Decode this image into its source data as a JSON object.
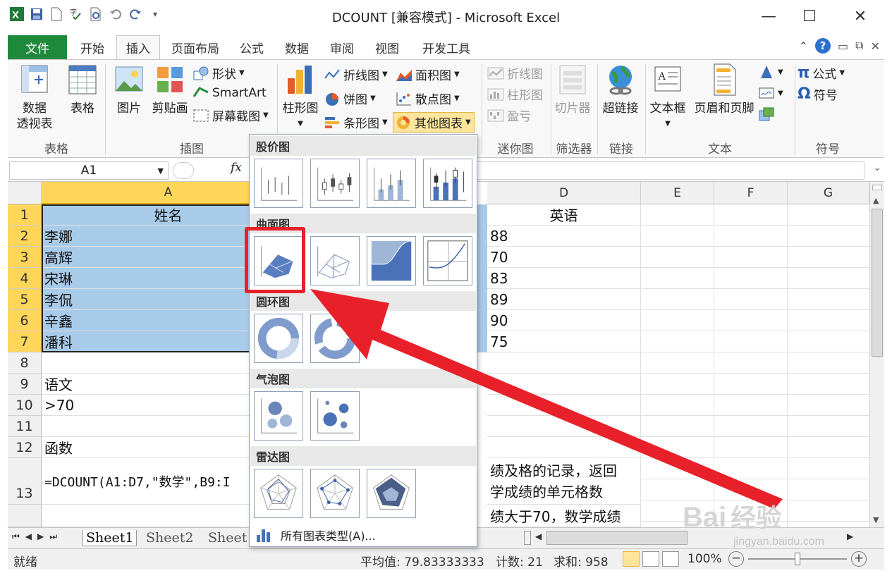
{
  "window": {
    "title": "DCOUNT  [兼容模式] - Microsoft Excel",
    "minimize": "—",
    "maximize": "☐",
    "close": "✕"
  },
  "tabs": [
    "文件",
    "开始",
    "插入",
    "页面布局",
    "公式",
    "数据",
    "审阅",
    "视图",
    "开发工具"
  ],
  "active_tab": "插入",
  "ribbon": {
    "groups": {
      "tables": "表格",
      "illustrations": "插图",
      "sparklines": "迷你图",
      "filter": "筛选器",
      "links": "链接",
      "text": "文本",
      "symbols": "符号"
    },
    "pivot_line1": "数据",
    "pivot_line2": "透视表",
    "table": "表格",
    "picture": "图片",
    "clipart": "剪贴画",
    "shapes": "形状",
    "smartart": "SmartArt",
    "screenshot": "屏幕截图",
    "column_chart": "柱形图",
    "line_chart": "折线图",
    "pie_chart": "饼图",
    "bar_chart": "条形图",
    "area_chart": "面积图",
    "scatter_chart": "散点图",
    "other_charts": "其他图表",
    "spark_line": "折线图",
    "spark_column": "柱形图",
    "spark_winloss": "盈亏",
    "slicer": "切片器",
    "hyperlink": "超链接",
    "textbox": "文本框",
    "header_footer": "页眉和页脚",
    "equation": "公式",
    "symbol": "符号"
  },
  "formula_bar": {
    "name_box": "A1",
    "fx": "fx"
  },
  "columns": [
    "A",
    "D",
    "E",
    "F",
    "G"
  ],
  "rows": [
    {
      "n": "1",
      "a": "姓名",
      "d": "英语"
    },
    {
      "n": "2",
      "a": "李娜",
      "d": "88"
    },
    {
      "n": "3",
      "a": "高辉",
      "d": "70"
    },
    {
      "n": "4",
      "a": "宋琳",
      "d": "83"
    },
    {
      "n": "5",
      "a": "李侃",
      "d": "89"
    },
    {
      "n": "6",
      "a": "辛鑫",
      "d": "90"
    },
    {
      "n": "7",
      "a": "潘科",
      "d": "75"
    },
    {
      "n": "8",
      "a": "",
      "d": ""
    },
    {
      "n": "9",
      "a": "语文",
      "d": ""
    },
    {
      "n": "10",
      "a": ">70",
      "d": ""
    },
    {
      "n": "11",
      "a": "",
      "d": ""
    },
    {
      "n": "12",
      "a": "函数",
      "d": ""
    },
    {
      "n": "13",
      "a": "=DCOUNT(A1:D7,\"数学\",B9:I",
      "d": "绩及格的记录，返回"
    }
  ],
  "row13_line2": "学成绩的单元格数",
  "row14_partial": "绩大于70，数学成绩",
  "sheets": [
    "Sheet1",
    "Sheet2",
    "Sheet"
  ],
  "status": {
    "ready": "就绪",
    "average": "平均值: 79.83333333",
    "count": "计数: 21",
    "sum": "求和: 958",
    "zoom": "100%"
  },
  "dropdown": {
    "sections": [
      "股价图",
      "曲面图",
      "圆环图",
      "气泡图",
      "雷达图"
    ],
    "all_types": "所有图表类型(A)..."
  },
  "watermark": {
    "main": "Bai",
    "cn": "经验",
    "url": "jingyan.baidu.com"
  },
  "colors": {
    "file_tab": "#1f8a3b",
    "selection": "#a9cbea",
    "header_selected": "#ffd55a",
    "highlight": "#e8202a"
  }
}
